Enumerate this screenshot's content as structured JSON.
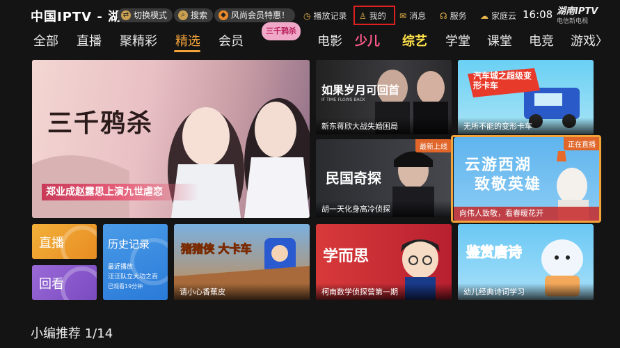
{
  "header": {
    "logo": "中国IPTV - 湖南",
    "switch_mode": "切换模式",
    "search": "搜索",
    "vip_promo": "风尚会员特惠！",
    "history": "播放记录",
    "mine": "我的",
    "messages": "消息",
    "service": "服务",
    "family_cloud": "家庭云",
    "time": "16:08",
    "brand": "湖南IPTV",
    "brand_sub": "电信新电视"
  },
  "nav": {
    "items": [
      "全部",
      "直播",
      "聚精彩",
      "精选",
      "会员",
      "三千鸦杀",
      "电影",
      "少儿",
      "综艺",
      "学堂",
      "课堂",
      "电竞",
      "游戏〉"
    ],
    "active_index": 3,
    "accent_color": "#f2a33a"
  },
  "tiles": {
    "hero": {
      "title": "三千鸦杀",
      "caption": "郑业成赵露思上演九世虐恋"
    },
    "t1": {
      "title": "如果岁月可回首",
      "subtitle": "IF TIME FLOWS BACK",
      "caption": "新东蒋欣大战失婚困局"
    },
    "t2": {
      "title": "汽车城之超级变形卡车",
      "caption": "无所不能的变形卡车"
    },
    "t3": {
      "title": "民国奇探",
      "caption": "胡一天化身高冷侦探",
      "badge": "最新上线"
    },
    "t4": {
      "title_line1": "云游西湖",
      "title_line2": "致敬英雄",
      "caption": "向伟人致敬，看春暖花开",
      "badge": "正在直播"
    },
    "live": {
      "label": "直播"
    },
    "replay": {
      "label": "回看"
    },
    "history_card": {
      "title": "历史记录",
      "line1": "最近播放",
      "line2": "汪汪队立大功之百",
      "line3": "已观看19分钟"
    },
    "t5": {
      "title": "猪猪侠 大卡车",
      "caption": "请小心香蕉皮"
    },
    "t6": {
      "title": "学而思",
      "caption": "柯南数学侦探营第一期"
    },
    "t7": {
      "title": "鉴赏唐诗",
      "caption": "幼儿经典诗词学习"
    }
  },
  "section": {
    "label": "小编推荐",
    "page": "1/14"
  }
}
